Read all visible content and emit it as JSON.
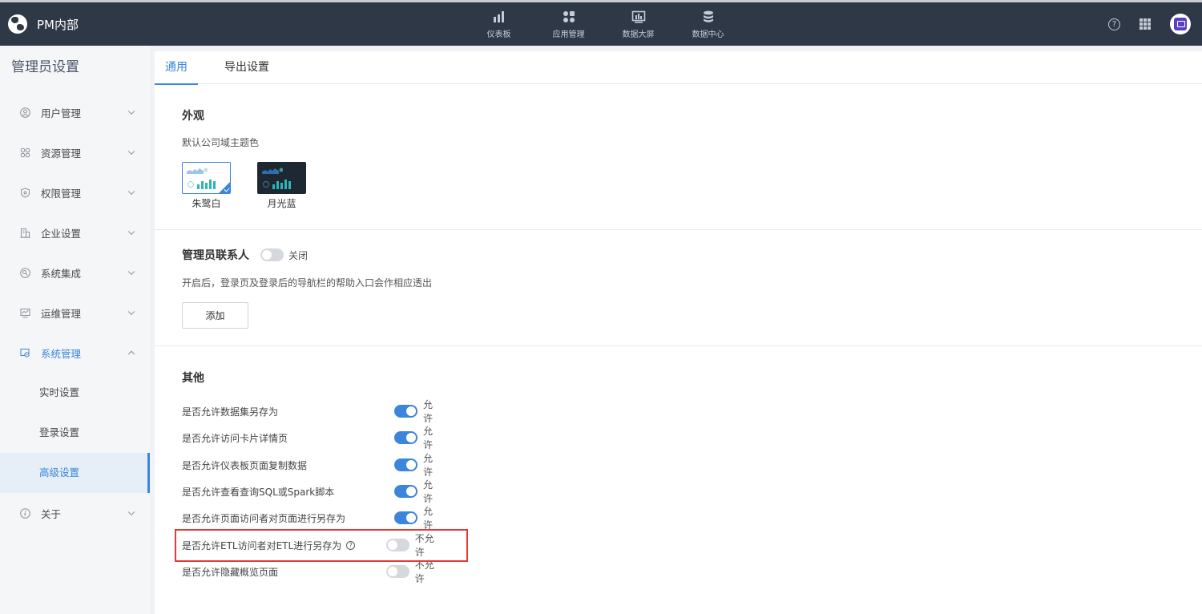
{
  "header": {
    "brand": "PM内部",
    "nav": [
      {
        "label": "仪表板",
        "icon": "bar-chart-icon"
      },
      {
        "label": "应用管理",
        "icon": "apps-icon"
      },
      {
        "label": "数据大屏",
        "icon": "screen-icon"
      },
      {
        "label": "数据中心",
        "icon": "database-icon"
      }
    ],
    "help_icon": "?"
  },
  "sidebar": {
    "title": "管理员设置",
    "items": [
      {
        "label": "用户管理",
        "icon": "user-icon"
      },
      {
        "label": "资源管理",
        "icon": "resource-icon"
      },
      {
        "label": "权限管理",
        "icon": "shield-icon"
      },
      {
        "label": "企业设置",
        "icon": "building-icon"
      },
      {
        "label": "系统集成",
        "icon": "integration-icon"
      },
      {
        "label": "运维管理",
        "icon": "monitor-icon"
      },
      {
        "label": "系统管理",
        "icon": "system-icon",
        "expanded": true
      },
      {
        "label": "关于",
        "icon": "info-icon"
      }
    ],
    "subitems": [
      {
        "label": "实时设置"
      },
      {
        "label": "登录设置"
      },
      {
        "label": "高级设置",
        "active": true
      }
    ]
  },
  "tabs": [
    {
      "label": "通用",
      "active": true
    },
    {
      "label": "导出设置"
    }
  ],
  "appearance": {
    "title": "外观",
    "theme_label": "默认公司域主题色",
    "themes": [
      {
        "name": "朱鹭白",
        "selected": true
      },
      {
        "name": "月光蓝"
      }
    ]
  },
  "contact": {
    "title": "管理员联系人",
    "toggle_text": "关闭",
    "toggle_on": false,
    "desc": "开启后，登录页及登录后的导航栏的帮助入口会作相应透出",
    "add_label": "添加"
  },
  "other": {
    "title": "其他",
    "rows": [
      {
        "label": "是否允许数据集另存为",
        "status": "允许",
        "on": true
      },
      {
        "label": "是否允许访问卡片详情页",
        "status": "允许",
        "on": true
      },
      {
        "label": "是否允许仪表板页面复制数据",
        "status": "允许",
        "on": true
      },
      {
        "label": "是否允许查看查询SQL或Spark脚本",
        "status": "允许",
        "on": true
      },
      {
        "label": "是否允许页面访问者对页面进行另存为",
        "status": "允许",
        "on": true
      },
      {
        "label": "是否允许ETL访问者对ETL进行另存为",
        "status": "不允许",
        "on": false,
        "has_help": true,
        "help_mark": "?",
        "highlighted": true
      },
      {
        "label": "是否允许隐藏概览页面",
        "status": "不允许",
        "on": false
      }
    ]
  },
  "colors": {
    "accent": "#3b85db",
    "header_bg": "#2e3847",
    "highlight": "#e53935"
  }
}
